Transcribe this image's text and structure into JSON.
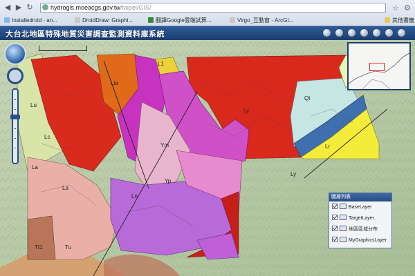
{
  "browser": {
    "url_host": "hydrogis.moeacgs.gov.tw",
    "url_path": "/taipei/GIS/",
    "bookmarks": [
      "Installedroid - an...",
      "DroidDraw: Graphi...",
      "翻譯Google雲端試算...",
      "Virgo_互動窗 - ArcGI..."
    ],
    "other_bookmarks": "其他書籤"
  },
  "app": {
    "title": "大台北地區特殊地質災害調查監測資料庫系統"
  },
  "legend": {
    "title": "圖層列表",
    "layers": [
      {
        "label": "BaseLayer",
        "checked": true
      },
      {
        "label": "TargetLayer",
        "checked": true
      },
      {
        "label": "地區區域分布",
        "checked": true
      },
      {
        "label": "MyGraphicsLayer",
        "checked": true
      }
    ]
  },
  "map_labels": [
    "L1",
    "Lia",
    "Lu",
    "Lc",
    "Ly",
    "La",
    "Ym",
    "Yp",
    "Ln",
    "Qt",
    "Lr",
    "TI1",
    "Tu",
    "La",
    "Ly"
  ],
  "icons": [
    "back-icon",
    "forward-icon",
    "reload-icon",
    "home-icon",
    "star-icon",
    "wrench-icon",
    "globe-icon",
    "pan-icon",
    "zoom-slider"
  ],
  "colors": {
    "appbar": "#1b3d70",
    "overview_frame": "#ee2222",
    "accent": "#2a4f86"
  }
}
